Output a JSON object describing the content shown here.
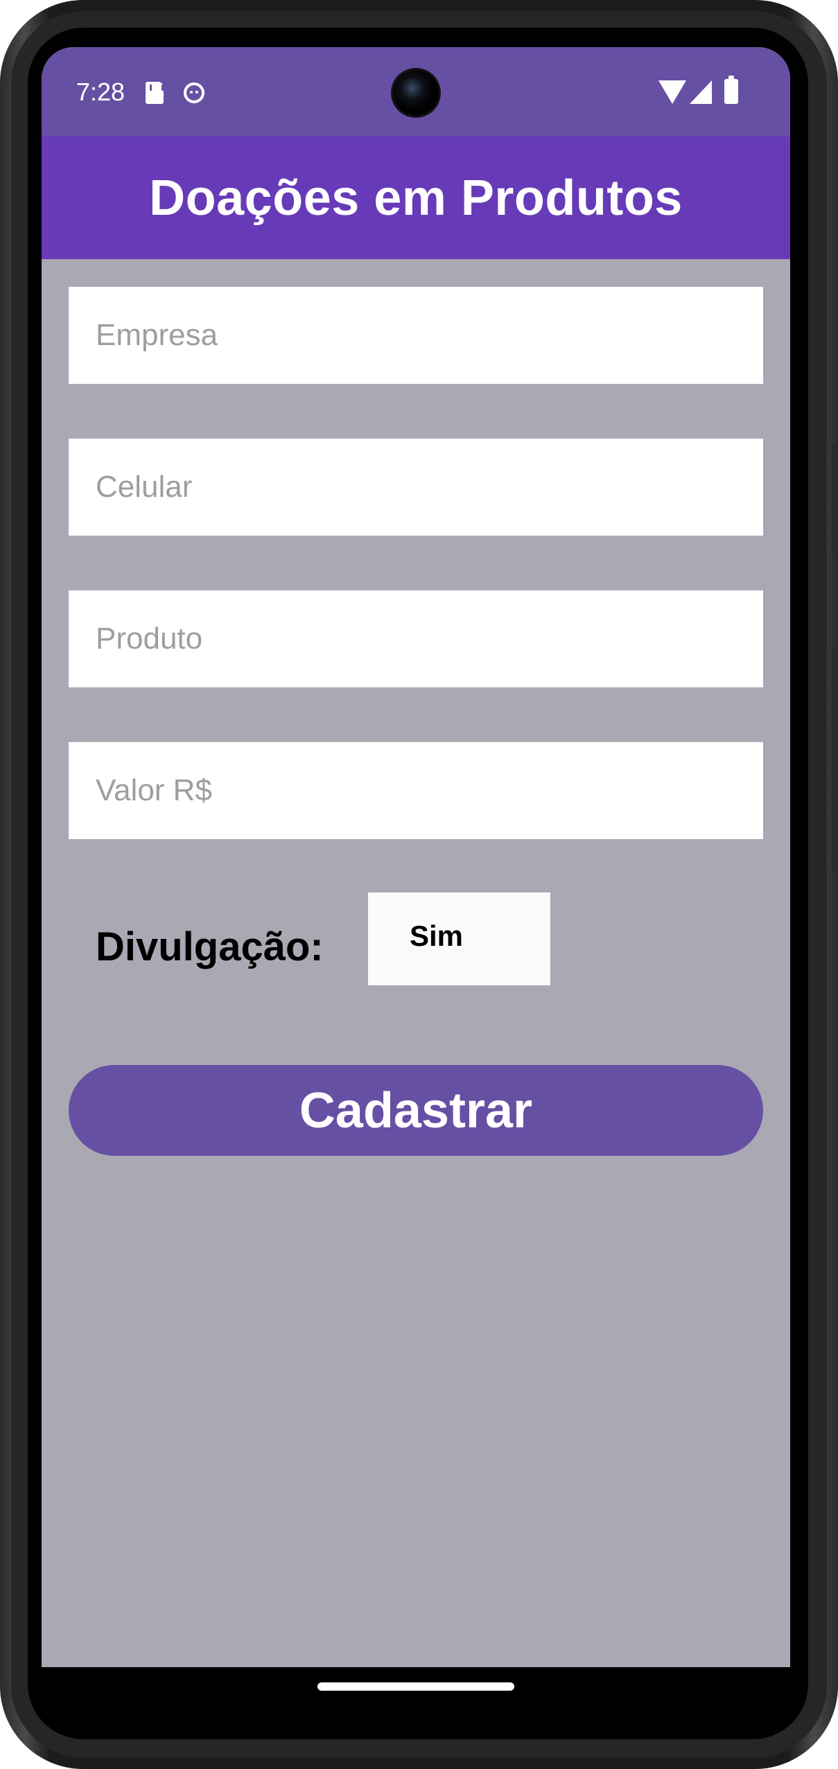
{
  "status_bar": {
    "time": "7:28",
    "icons": [
      "sd-card-icon",
      "robot-icon",
      "wifi-icon",
      "signal-icon",
      "battery-icon"
    ]
  },
  "app_bar": {
    "title": "Doações em Produtos",
    "color": "#673ab7"
  },
  "form": {
    "empresa": {
      "placeholder": "Empresa",
      "value": ""
    },
    "celular": {
      "placeholder": "Celular",
      "value": ""
    },
    "produto": {
      "placeholder": "Produto",
      "value": ""
    },
    "valor": {
      "placeholder": "Valor R$",
      "value": ""
    },
    "divulgacao": {
      "label": "Divulgação:",
      "selected": "Sim"
    },
    "submit_label": "Cadastrar"
  },
  "colors": {
    "status_bar": "#6650a3",
    "background": "#a9a8b3",
    "button": "#6650a3"
  }
}
